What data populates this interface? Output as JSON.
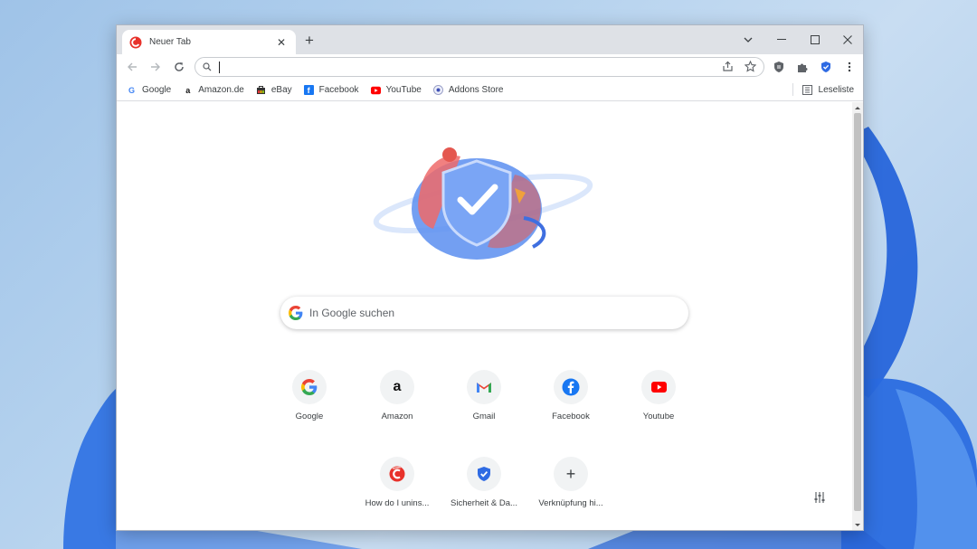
{
  "window": {
    "tab_title": "Neuer Tab",
    "new_tab_symbol": "+",
    "controls": [
      "chevron-down",
      "minimize",
      "maximize",
      "close"
    ]
  },
  "toolbar": {
    "omnibox_value": ""
  },
  "bookmarks": [
    {
      "label": "Google",
      "icon": "google-icon"
    },
    {
      "label": "Amazon.de",
      "icon": "amazon-icon"
    },
    {
      "label": "eBay",
      "icon": "ebay-icon"
    },
    {
      "label": "Facebook",
      "icon": "facebook-icon"
    },
    {
      "label": "YouTube",
      "icon": "youtube-icon"
    },
    {
      "label": "Addons Store",
      "icon": "addons-store-icon"
    }
  ],
  "reading_list": {
    "label": "Leseliste"
  },
  "search": {
    "placeholder": "In Google suchen"
  },
  "shortcuts": [
    {
      "label": "Google",
      "icon": "google-icon"
    },
    {
      "label": "Amazon",
      "icon": "amazon-icon"
    },
    {
      "label": "Gmail",
      "icon": "gmail-icon"
    },
    {
      "label": "Facebook",
      "icon": "facebook-icon"
    },
    {
      "label": "Youtube",
      "icon": "youtube-icon"
    },
    {
      "label": "How do I unins...",
      "icon": "ccleaner-icon"
    },
    {
      "label": "Sicherheit & Da...",
      "icon": "shield-icon"
    },
    {
      "label": "Verknüpfung hi...",
      "icon": "plus-icon",
      "symbol": "+"
    }
  ],
  "colors": {
    "accent": "#1a73e8",
    "tab_strip": "#dee1e6",
    "youtube_red": "#ff0000",
    "facebook_blue": "#1877f2"
  }
}
